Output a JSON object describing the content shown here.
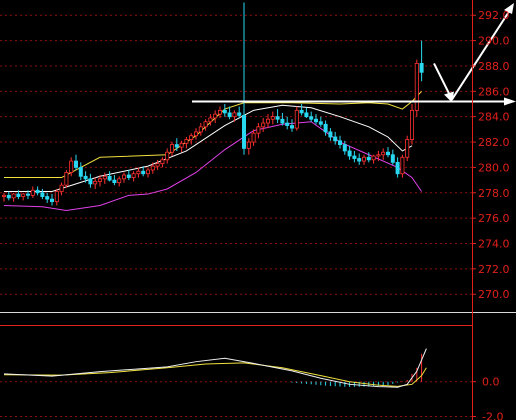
{
  "chart_data": {
    "type": "candlestick",
    "price_ticks": [
      "292.0",
      "290.0",
      "288.0",
      "286.0",
      "284.0",
      "282.0",
      "280.0",
      "278.0",
      "276.0",
      "274.0",
      "272.0",
      "270.0"
    ],
    "price_range": [
      268.6,
      293.2
    ],
    "macd_ticks": [
      "0.0",
      "-2.0"
    ],
    "macd_range": [
      -2.2,
      3.2
    ],
    "grid": true,
    "reference_level": 285.2,
    "colors": {
      "background": "#000000",
      "grid": "#8a1010",
      "axis": "#e0201b",
      "candle_up": "#ff3030",
      "candle_down": "#29d8f0",
      "boll_upper": "#f0e040",
      "boll_mid": "#ffffff",
      "boll_lower": "#e040e8",
      "dif": "#f0f0f0",
      "dea": "#f0e040",
      "annotation": "#ffffff"
    },
    "candles": [
      [
        277.7,
        278.0,
        277.3,
        277.8
      ],
      [
        277.8,
        278.1,
        277.4,
        277.6
      ],
      [
        277.6,
        278.0,
        277.3,
        277.9
      ],
      [
        277.9,
        278.2,
        277.5,
        277.7
      ],
      [
        277.7,
        278.0,
        277.4,
        277.9
      ],
      [
        277.9,
        278.2,
        277.5,
        277.8
      ],
      [
        277.8,
        278.5,
        277.6,
        278.2
      ],
      [
        278.2,
        278.5,
        277.8,
        278.0
      ],
      [
        278.0,
        278.3,
        277.5,
        277.7
      ],
      [
        277.7,
        278.0,
        277.2,
        277.5
      ],
      [
        277.5,
        277.9,
        277.0,
        277.3
      ],
      [
        277.3,
        278.3,
        277.0,
        278.1
      ],
      [
        278.1,
        278.8,
        277.8,
        278.6
      ],
      [
        278.6,
        279.8,
        278.4,
        279.6
      ],
      [
        279.6,
        280.8,
        279.3,
        280.5
      ],
      [
        280.5,
        281.0,
        279.8,
        280.0
      ],
      [
        280.0,
        280.4,
        279.0,
        279.3
      ],
      [
        279.3,
        279.7,
        278.8,
        279.1
      ],
      [
        279.1,
        279.5,
        278.4,
        278.7
      ],
      [
        278.7,
        279.2,
        278.3,
        278.9
      ],
      [
        278.9,
        279.4,
        278.5,
        279.1
      ],
      [
        279.1,
        279.6,
        278.7,
        279.3
      ],
      [
        279.3,
        279.7,
        278.9,
        279.0
      ],
      [
        279.0,
        279.4,
        278.6,
        278.8
      ],
      [
        278.8,
        279.3,
        278.5,
        279.1
      ],
      [
        279.1,
        279.6,
        278.8,
        279.4
      ],
      [
        279.4,
        279.8,
        279.0,
        279.2
      ],
      [
        279.2,
        279.7,
        278.9,
        279.5
      ],
      [
        279.5,
        280.0,
        279.2,
        279.7
      ],
      [
        279.7,
        280.1,
        279.3,
        279.5
      ],
      [
        279.5,
        280.0,
        279.2,
        279.8
      ],
      [
        279.8,
        280.4,
        279.5,
        280.1
      ],
      [
        280.1,
        280.6,
        279.8,
        280.3
      ],
      [
        280.3,
        280.8,
        280.0,
        280.6
      ],
      [
        280.6,
        281.5,
        280.3,
        281.2
      ],
      [
        281.2,
        282.0,
        280.9,
        281.8
      ],
      [
        281.8,
        282.3,
        281.3,
        281.6
      ],
      [
        281.6,
        282.1,
        281.2,
        281.9
      ],
      [
        281.9,
        282.4,
        281.5,
        282.2
      ],
      [
        282.2,
        282.7,
        281.8,
        282.5
      ],
      [
        282.5,
        283.1,
        282.2,
        282.8
      ],
      [
        282.8,
        283.5,
        282.5,
        283.2
      ],
      [
        283.2,
        283.8,
        282.9,
        283.6
      ],
      [
        283.6,
        284.2,
        283.3,
        283.9
      ],
      [
        283.9,
        284.5,
        283.5,
        284.2
      ],
      [
        284.2,
        284.8,
        283.9,
        284.5
      ],
      [
        284.5,
        285.0,
        284.0,
        284.3
      ],
      [
        284.3,
        284.8,
        283.8,
        284.0
      ],
      [
        284.0,
        284.5,
        283.6,
        284.3
      ],
      [
        284.3,
        284.8,
        283.9,
        284.1
      ],
      [
        284.1,
        293.0,
        281.0,
        281.5
      ],
      [
        281.5,
        282.3,
        281.0,
        282.0
      ],
      [
        282.0,
        283.0,
        281.7,
        282.7
      ],
      [
        282.7,
        283.5,
        282.3,
        283.2
      ],
      [
        283.2,
        283.9,
        282.8,
        283.5
      ],
      [
        283.5,
        284.2,
        283.1,
        283.8
      ],
      [
        283.8,
        284.4,
        283.4,
        284.0
      ],
      [
        284.0,
        284.6,
        283.5,
        283.8
      ],
      [
        283.8,
        284.3,
        283.3,
        283.5
      ],
      [
        283.5,
        284.0,
        283.0,
        283.3
      ],
      [
        283.3,
        283.8,
        282.8,
        283.1
      ],
      [
        283.1,
        284.8,
        282.9,
        284.5
      ],
      [
        284.5,
        285.0,
        284.1,
        284.3
      ],
      [
        284.3,
        284.7,
        283.9,
        284.0
      ],
      [
        284.0,
        284.4,
        283.6,
        283.8
      ],
      [
        283.8,
        284.2,
        283.4,
        283.6
      ],
      [
        283.6,
        284.0,
        283.2,
        283.4
      ],
      [
        283.4,
        283.7,
        282.5,
        282.8
      ],
      [
        282.8,
        283.1,
        282.1,
        282.4
      ],
      [
        282.4,
        282.8,
        281.8,
        282.1
      ],
      [
        282.1,
        282.5,
        281.5,
        281.8
      ],
      [
        281.8,
        282.1,
        281.0,
        281.3
      ],
      [
        281.3,
        281.7,
        280.6,
        280.9
      ],
      [
        280.9,
        281.3,
        280.4,
        280.7
      ],
      [
        280.7,
        281.1,
        280.2,
        280.5
      ],
      [
        280.5,
        281.0,
        280.2,
        280.8
      ],
      [
        280.8,
        281.2,
        280.4,
        280.6
      ],
      [
        280.6,
        281.0,
        280.3,
        280.9
      ],
      [
        280.9,
        281.3,
        280.5,
        281.0
      ],
      [
        281.0,
        281.5,
        280.6,
        281.2
      ],
      [
        281.2,
        281.6,
        280.8,
        281.0
      ],
      [
        281.0,
        281.4,
        280.2,
        280.4
      ],
      [
        280.4,
        280.8,
        279.2,
        279.5
      ],
      [
        279.5,
        281.0,
        279.2,
        280.8
      ],
      [
        280.8,
        282.5,
        280.5,
        282.2
      ],
      [
        282.2,
        285.0,
        281.8,
        284.5
      ],
      [
        284.5,
        288.5,
        284.0,
        288.2
      ],
      [
        288.2,
        290.0,
        286.8,
        287.5
      ]
    ],
    "bollinger": {
      "upper": [
        [
          0,
          279.2
        ],
        [
          12,
          279.2
        ],
        [
          20,
          280.8
        ],
        [
          34,
          281.0
        ],
        [
          40,
          282.5
        ],
        [
          46,
          284.6
        ],
        [
          50,
          285.1
        ],
        [
          60,
          285.1
        ],
        [
          70,
          285.0
        ],
        [
          76,
          285.1
        ],
        [
          80,
          285.0
        ],
        [
          83,
          284.6
        ],
        [
          85,
          285.2
        ],
        [
          87,
          286.0
        ]
      ],
      "middle": [
        [
          0,
          278.1
        ],
        [
          10,
          278.1
        ],
        [
          20,
          279.3
        ],
        [
          30,
          280.1
        ],
        [
          38,
          281.3
        ],
        [
          46,
          283.3
        ],
        [
          52,
          284.5
        ],
        [
          58,
          284.9
        ],
        [
          64,
          284.7
        ],
        [
          70,
          284.0
        ],
        [
          76,
          283.2
        ],
        [
          80,
          282.4
        ],
        [
          83,
          281.3
        ],
        [
          85,
          281.7
        ]
      ],
      "lower": [
        [
          0,
          277.0
        ],
        [
          8,
          276.9
        ],
        [
          13,
          276.6
        ],
        [
          20,
          277.0
        ],
        [
          26,
          277.8
        ],
        [
          30,
          277.9
        ],
        [
          34,
          278.3
        ],
        [
          40,
          279.6
        ],
        [
          46,
          281.4
        ],
        [
          52,
          282.9
        ],
        [
          58,
          283.4
        ],
        [
          64,
          283.6
        ],
        [
          70,
          282.0
        ],
        [
          76,
          281.0
        ],
        [
          82,
          280.0
        ],
        [
          85,
          279.2
        ],
        [
          87,
          278.1
        ]
      ]
    },
    "macd": {
      "dif": [
        [
          0,
          0.45
        ],
        [
          10,
          0.32
        ],
        [
          20,
          0.58
        ],
        [
          34,
          0.85
        ],
        [
          40,
          1.15
        ],
        [
          46,
          1.35
        ],
        [
          52,
          1.05
        ],
        [
          60,
          0.62
        ],
        [
          66,
          0.2
        ],
        [
          72,
          -0.15
        ],
        [
          78,
          -0.28
        ],
        [
          82,
          -0.32
        ],
        [
          84,
          -0.15
        ],
        [
          86,
          0.6
        ],
        [
          88,
          1.9
        ]
      ],
      "dea": [
        [
          0,
          0.4
        ],
        [
          12,
          0.38
        ],
        [
          22,
          0.52
        ],
        [
          34,
          0.8
        ],
        [
          42,
          1.02
        ],
        [
          50,
          1.08
        ],
        [
          58,
          0.8
        ],
        [
          66,
          0.35
        ],
        [
          72,
          0.0
        ],
        [
          78,
          -0.2
        ],
        [
          82,
          -0.27
        ],
        [
          85,
          -0.15
        ],
        [
          87,
          0.35
        ],
        [
          88,
          0.8
        ]
      ],
      "hist": [
        [
          60,
          -0.05
        ],
        [
          64,
          -0.15
        ],
        [
          68,
          -0.25
        ],
        [
          72,
          -0.3
        ],
        [
          76,
          -0.28
        ],
        [
          80,
          -0.2
        ],
        [
          84,
          0.1
        ],
        [
          86,
          0.8
        ],
        [
          87,
          1.6
        ],
        [
          88,
          2.4
        ]
      ]
    }
  }
}
